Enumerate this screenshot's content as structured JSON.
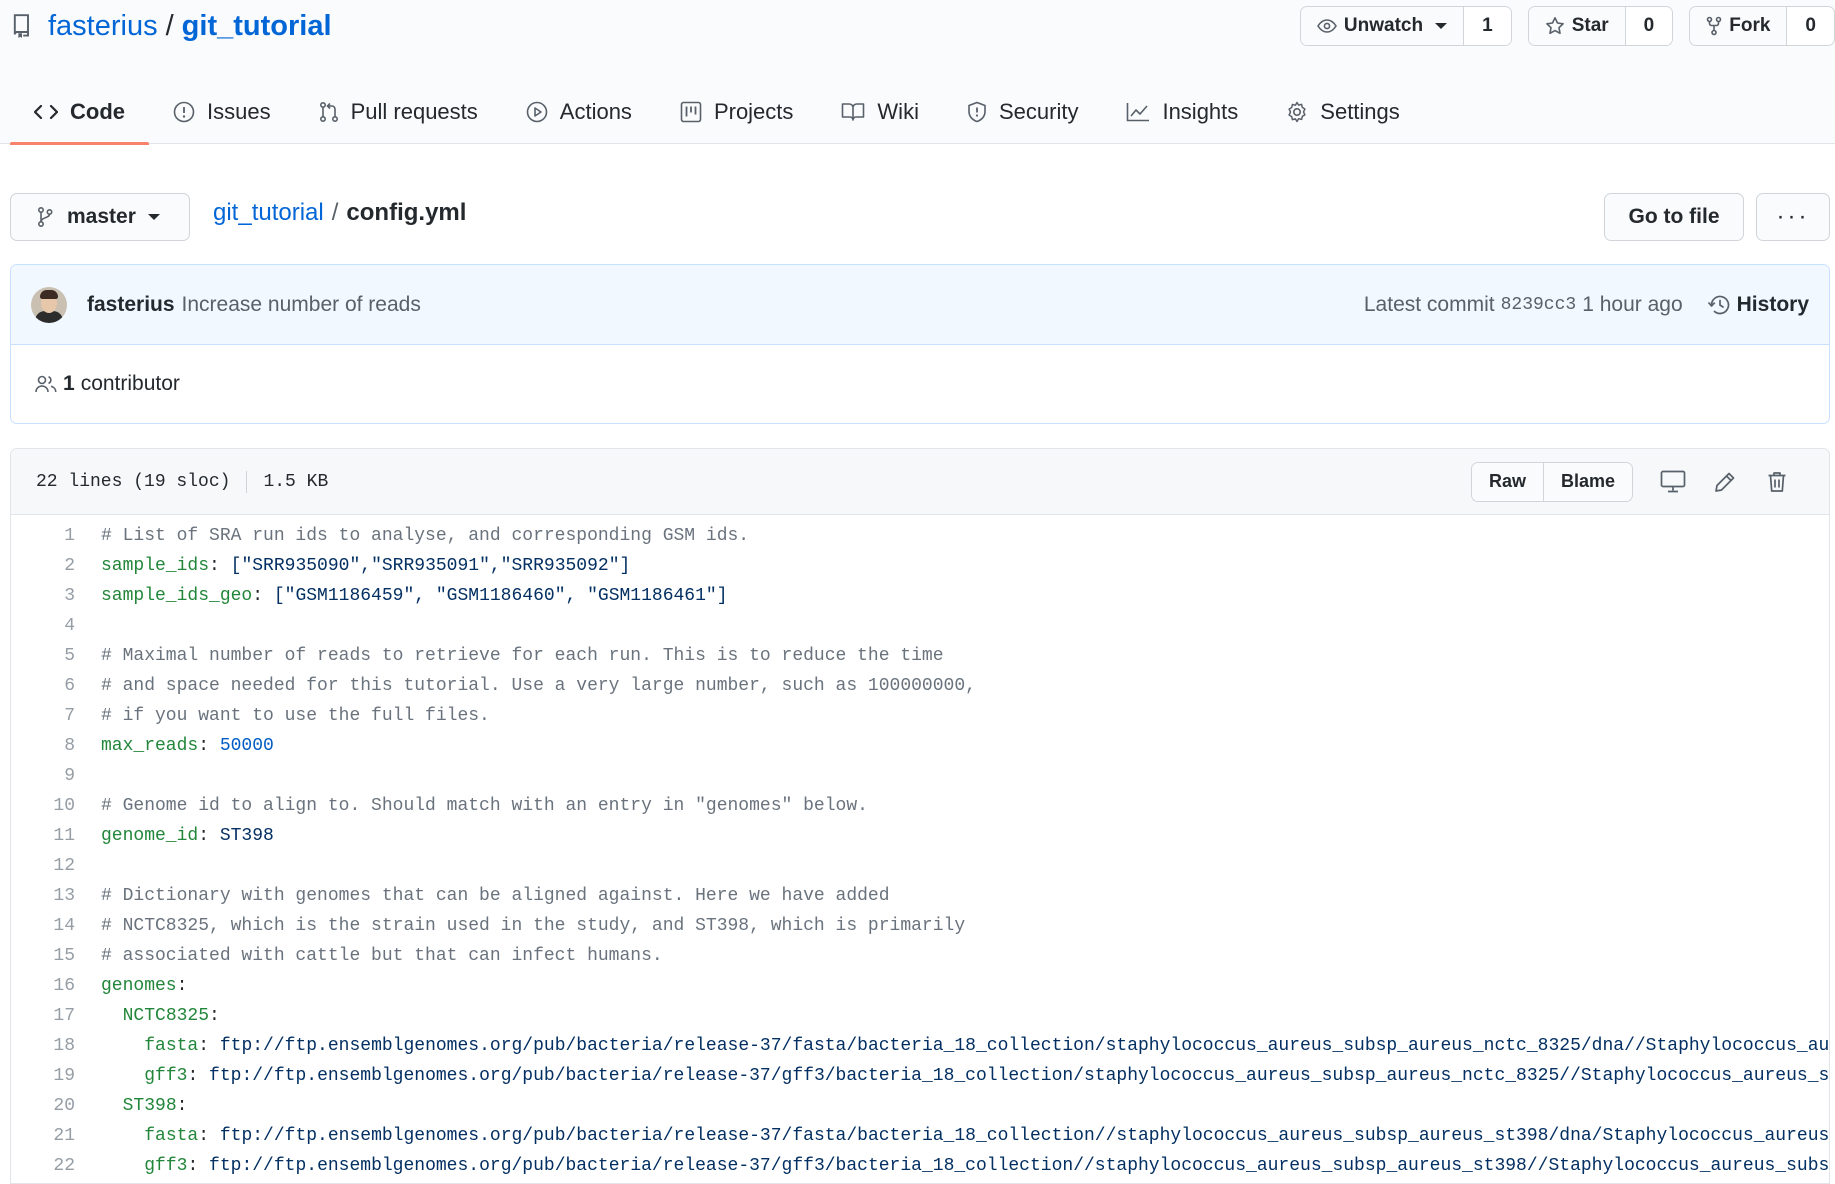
{
  "repo": {
    "owner": "fasterius",
    "separator": "/",
    "name": "git_tutorial"
  },
  "actions": {
    "watch": {
      "label": "Unwatch",
      "count": "1"
    },
    "star": {
      "label": "Star",
      "count": "0"
    },
    "fork": {
      "label": "Fork",
      "count": "0"
    }
  },
  "tabs": [
    {
      "label": "Code",
      "icon": "code-icon",
      "selected": true
    },
    {
      "label": "Issues",
      "icon": "issue-icon"
    },
    {
      "label": "Pull requests",
      "icon": "pull-request-icon"
    },
    {
      "label": "Actions",
      "icon": "play-icon"
    },
    {
      "label": "Projects",
      "icon": "project-icon"
    },
    {
      "label": "Wiki",
      "icon": "book-icon"
    },
    {
      "label": "Security",
      "icon": "shield-icon"
    },
    {
      "label": "Insights",
      "icon": "graph-icon"
    },
    {
      "label": "Settings",
      "icon": "gear-icon"
    }
  ],
  "branch": {
    "name": "master"
  },
  "breadcrumb": {
    "repo": "git_tutorial",
    "separator": "/",
    "file": "config.yml"
  },
  "buttons": {
    "goto_file": "Go to file",
    "more": "···"
  },
  "commit": {
    "author": "fasterius",
    "message": "Increase number of reads",
    "latest_label": "Latest commit",
    "sha": "8239cc3",
    "time": "1 hour ago",
    "history": "History"
  },
  "contributors": {
    "count": "1",
    "label": "contributor"
  },
  "file": {
    "lines_info": "22 lines (19 sloc)",
    "size": "1.5 KB",
    "raw_label": "Raw",
    "blame_label": "Blame"
  },
  "code_lines": [
    [
      [
        "c",
        "# List of SRA run ids to analyse, and corresponding GSM ids."
      ]
    ],
    [
      [
        "k",
        "sample_ids"
      ],
      [
        "p",
        ": "
      ],
      [
        "s",
        "[\"SRR935090\",\"SRR935091\",\"SRR935092\"]"
      ]
    ],
    [
      [
        "k",
        "sample_ids_geo"
      ],
      [
        "p",
        ": "
      ],
      [
        "s",
        "[\"GSM1186459\", \"GSM1186460\", \"GSM1186461\"]"
      ]
    ],
    [],
    [
      [
        "c",
        "# Maximal number of reads to retrieve for each run. This is to reduce the time"
      ]
    ],
    [
      [
        "c",
        "# and space needed for this tutorial. Use a very large number, such as 100000000,"
      ]
    ],
    [
      [
        "c",
        "# if you want to use the full files."
      ]
    ],
    [
      [
        "k",
        "max_reads"
      ],
      [
        "p",
        ": "
      ],
      [
        "n",
        "50000"
      ]
    ],
    [],
    [
      [
        "c",
        "# Genome id to align to. Should match with an entry in \"genomes\" below."
      ]
    ],
    [
      [
        "k",
        "genome_id"
      ],
      [
        "p",
        ": "
      ],
      [
        "s",
        "ST398"
      ]
    ],
    [],
    [
      [
        "c",
        "# Dictionary with genomes that can be aligned against. Here we have added"
      ]
    ],
    [
      [
        "c",
        "# NCTC8325, which is the strain used in the study, and ST398, which is primarily"
      ]
    ],
    [
      [
        "c",
        "# associated with cattle but that can infect humans."
      ]
    ],
    [
      [
        "k",
        "genomes"
      ],
      [
        "p",
        ":"
      ]
    ],
    [
      [
        "p",
        "  "
      ],
      [
        "k",
        "NCTC8325"
      ],
      [
        "p",
        ":"
      ]
    ],
    [
      [
        "p",
        "    "
      ],
      [
        "k",
        "fasta"
      ],
      [
        "p",
        ": "
      ],
      [
        "s",
        "ftp://ftp.ensemblgenomes.org/pub/bacteria/release-37/fasta/bacteria_18_collection/staphylococcus_aureus_subsp_aureus_nctc_8325/dna//Staphylococcus_au"
      ]
    ],
    [
      [
        "p",
        "    "
      ],
      [
        "k",
        "gff3"
      ],
      [
        "p",
        ": "
      ],
      [
        "s",
        "ftp://ftp.ensemblgenomes.org/pub/bacteria/release-37/gff3/bacteria_18_collection/staphylococcus_aureus_subsp_aureus_nctc_8325//Staphylococcus_aureus_s"
      ]
    ],
    [
      [
        "p",
        "  "
      ],
      [
        "k",
        "ST398"
      ],
      [
        "p",
        ":"
      ]
    ],
    [
      [
        "p",
        "    "
      ],
      [
        "k",
        "fasta"
      ],
      [
        "p",
        ": "
      ],
      [
        "s",
        "ftp://ftp.ensemblgenomes.org/pub/bacteria/release-37/fasta/bacteria_18_collection//staphylococcus_aureus_subsp_aureus_st398/dna/Staphylococcus_aureus"
      ]
    ],
    [
      [
        "p",
        "    "
      ],
      [
        "k",
        "gff3"
      ],
      [
        "p",
        ": "
      ],
      [
        "s",
        "ftp://ftp.ensemblgenomes.org/pub/bacteria/release-37/gff3/bacteria_18_collection//staphylococcus_aureus_subsp_aureus_st398//Staphylococcus_aureus_subsp"
      ]
    ]
  ]
}
